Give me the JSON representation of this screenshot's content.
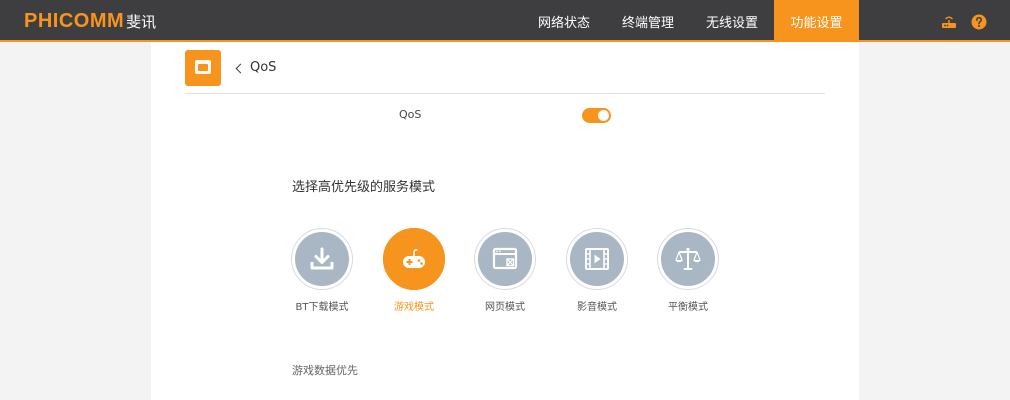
{
  "header": {
    "logo_text": "PHICOMM",
    "logo_cn": "斐讯",
    "nav": [
      "网络状态",
      "终端管理",
      "无线设置",
      "功能设置"
    ],
    "active_nav": "功能设置",
    "icons": [
      "router-icon",
      "help-icon"
    ]
  },
  "page": {
    "back_label": "QoS",
    "qos_label": "QoS",
    "qos_enabled": true,
    "section_title": "选择高优先级的服务模式",
    "modes": [
      {
        "label": "BT下载模式",
        "icon": "download-icon",
        "active": false
      },
      {
        "label": "游戏模式",
        "icon": "gamepad-icon",
        "active": true
      },
      {
        "label": "网页模式",
        "icon": "webpage-icon",
        "active": false
      },
      {
        "label": "影音模式",
        "icon": "video-icon",
        "active": false
      },
      {
        "label": "平衡模式",
        "icon": "balance-scale-icon",
        "active": false
      }
    ],
    "description": "游戏数据优先"
  },
  "colors": {
    "accent": "#f7941d",
    "header_bg": "#3e3e40",
    "mode_inactive": "#a9b6c3"
  }
}
